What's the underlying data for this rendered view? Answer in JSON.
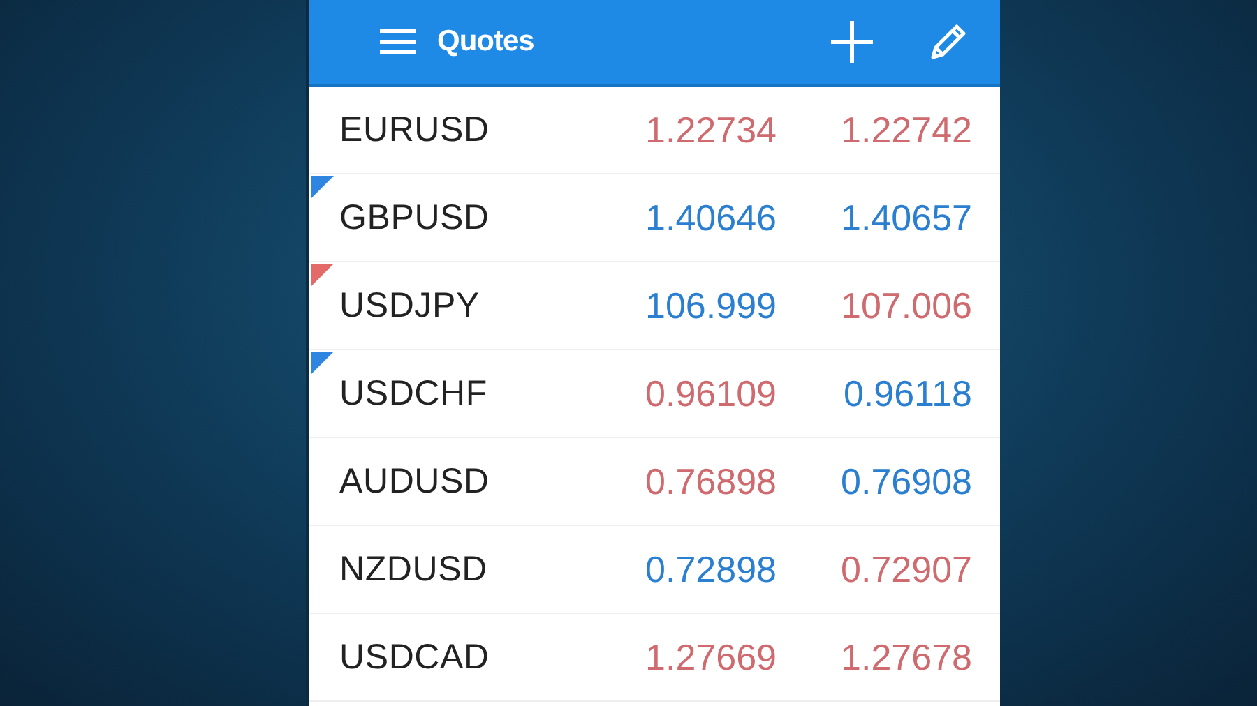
{
  "toolbar": {
    "title": "Quotes"
  },
  "quotes": [
    {
      "symbol": "EURUSD",
      "bid": {
        "value": "1.22734",
        "color": "#cf6a6f"
      },
      "ask": {
        "value": "1.22742",
        "color": "#cf6a6f"
      }
    },
    {
      "symbol": "GBPUSD",
      "bid": {
        "value": "1.40646",
        "color": "#2a7fd0"
      },
      "ask": {
        "value": "1.40657",
        "color": "#2a7fd0"
      },
      "marker": {
        "color": "#2f86e0"
      }
    },
    {
      "symbol": "USDJPY",
      "bid": {
        "value": "106.999",
        "color": "#2a7fd0"
      },
      "ask": {
        "value": "107.006",
        "color": "#cf6a6f"
      },
      "marker": {
        "color": "#e46a6a"
      }
    },
    {
      "symbol": "USDCHF",
      "bid": {
        "value": "0.96109",
        "color": "#cf6a6f"
      },
      "ask": {
        "value": "0.96118",
        "color": "#2a7fd0"
      },
      "marker": {
        "color": "#2f86e0"
      }
    },
    {
      "symbol": "AUDUSD",
      "bid": {
        "value": "0.76898",
        "color": "#cf6a6f"
      },
      "ask": {
        "value": "0.76908",
        "color": "#2a7fd0"
      }
    },
    {
      "symbol": "NZDUSD",
      "bid": {
        "value": "0.72898",
        "color": "#2a7fd0"
      },
      "ask": {
        "value": "0.72907",
        "color": "#cf6a6f"
      }
    },
    {
      "symbol": "USDCAD",
      "bid": {
        "value": "1.27669",
        "color": "#cf6a6f"
      },
      "ask": {
        "value": "1.27678",
        "color": "#cf6a6f"
      }
    }
  ]
}
